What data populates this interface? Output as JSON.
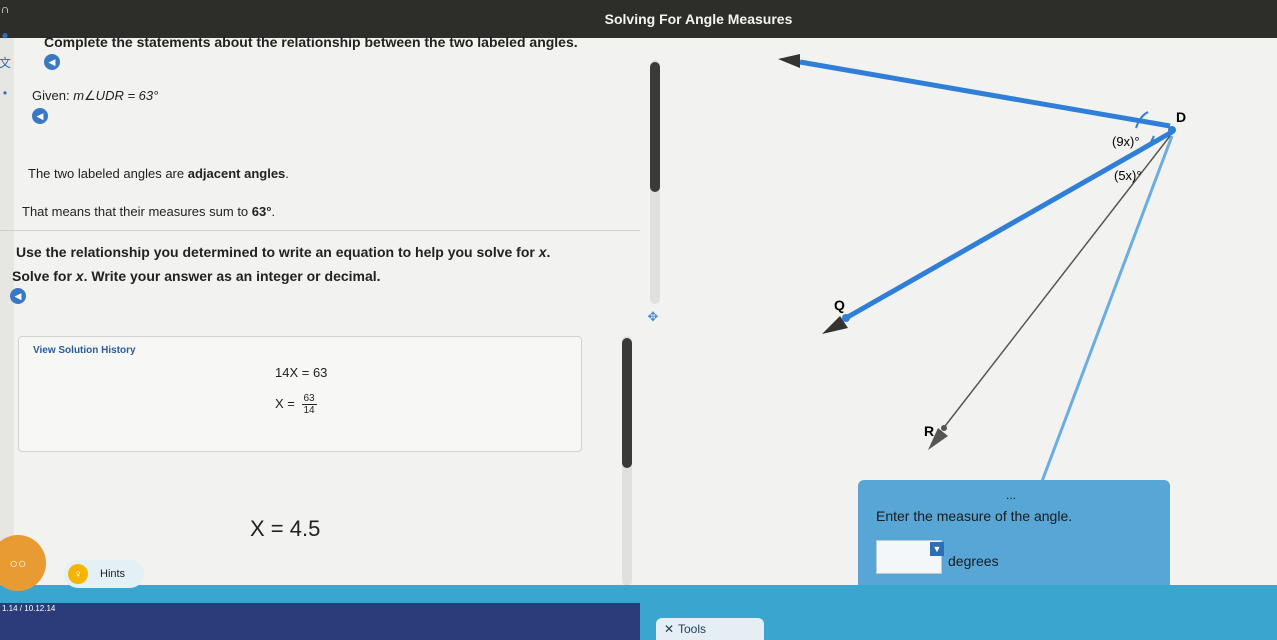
{
  "app": {
    "title": "Solving For Angle Measures"
  },
  "instructions": {
    "main": "Complete the statements about the relationship between the two labeled angles.",
    "given_prefix": "Given:",
    "given_expr": "m∠UDR = 63°",
    "adjacent_prefix": "The two labeled angles are",
    "adjacent_value": "adjacent angles",
    "adjacent_suffix": ".",
    "sum_prefix": "That means that their measures sum to",
    "sum_value": "63°",
    "sum_suffix": ".",
    "use_relationship": "Use the relationship you determined to write an equation to help you solve for",
    "use_var": "x",
    "use_suffix": ".",
    "solve_prefix": "Solve for",
    "solve_var": "x",
    "solve_suffix": ". Write your answer as an integer or decimal."
  },
  "solution_history": {
    "label": "View Solution History",
    "eq1": "14X = 63",
    "eq2_left": "X =",
    "eq2_num": "63",
    "eq2_den": "14"
  },
  "answer": {
    "value": "X = 4.5"
  },
  "diagram": {
    "point_d": "D",
    "point_q": "Q",
    "point_r": "R",
    "angle_1": "(9x)°",
    "angle_2": "(5x)°"
  },
  "answer_panel": {
    "ellipsis": "...",
    "prompt": "Enter the measure of the angle.",
    "unit": "degrees"
  },
  "bottom": {
    "hints_label": "Hints",
    "timestamp": "1.14 / 10.12.14",
    "tools_label": "Tools"
  },
  "colors": {
    "topbar": "#2d2d2a",
    "ray_blue": "#2f7fd8",
    "panel_blue": "#58a6d6",
    "bottom_bar": "#3aa6cf"
  }
}
